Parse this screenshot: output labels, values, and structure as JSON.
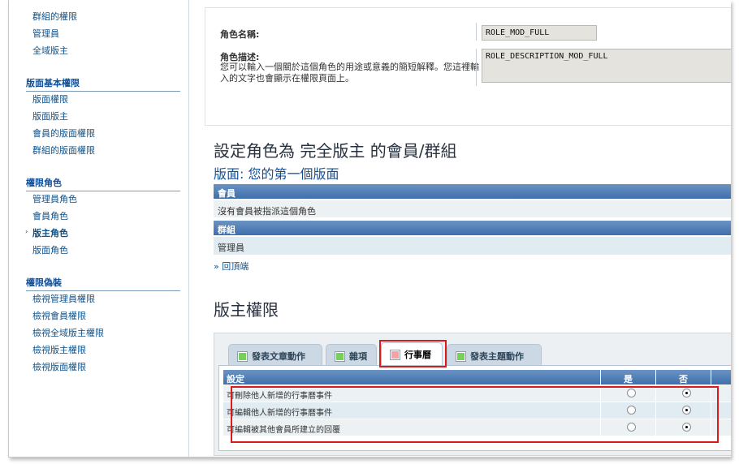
{
  "sidebar": {
    "top_items": [
      "群組的權限",
      "管理員",
      "全域版主"
    ],
    "groups": [
      {
        "title": "版面基本權限",
        "items": [
          "版面權限",
          "版面版主",
          "會員的版面權限",
          "群組的版面權限"
        ]
      },
      {
        "title": "權限角色",
        "items": [
          "管理員角色",
          "會員角色",
          "版主角色",
          "版面角色"
        ],
        "active_index": 2
      },
      {
        "title": "權限偽裝",
        "items": [
          "檢視管理員權限",
          "檢視會員權限",
          "檢視全域版主權限",
          "檢視版主權限",
          "檢視版面權限"
        ]
      }
    ],
    "active_marker": "›"
  },
  "role_form": {
    "name_label": "角色名稱:",
    "name_value": "ROLE_MOD_FULL",
    "desc_label": "角色描述:",
    "desc_help": "您可以輸入一個關於這個角色的用途或意義的簡短解釋。您這裡輸入的文字也會顯示在權限頁面上。",
    "desc_value": "ROLE_DESCRIPTION_MOD_FULL"
  },
  "assign": {
    "title": "設定角色為 完全版主 的會員/群組",
    "forum_subtitle": "版面: 您的第一個版面",
    "members_header": "會員",
    "members_empty": "沒有會員被指派這個角色",
    "groups_header": "群組",
    "group_row": "管理員",
    "back_to_top": "» 回頂端"
  },
  "perms": {
    "title": "版主權限",
    "tabs": [
      {
        "label": "發表文章動作",
        "color": "green"
      },
      {
        "label": "雜項",
        "color": "green"
      },
      {
        "label": "行事曆",
        "color": "red",
        "active": true
      },
      {
        "label": "發表主題動作",
        "color": "green"
      }
    ],
    "columns": {
      "setting": "設定",
      "yes": "是",
      "no": "否"
    },
    "rows": [
      {
        "label": "可刪除他人新增的行事曆事件",
        "value": "no"
      },
      {
        "label": "可編輯他人新增的行事曆事件",
        "value": "no"
      },
      {
        "label": "可編輯被其他會員所建立的回覆",
        "value": "no"
      }
    ]
  },
  "colors": {
    "highlight": "#d91b1b",
    "link": "#105289",
    "header_blue": "#3f6fab"
  }
}
